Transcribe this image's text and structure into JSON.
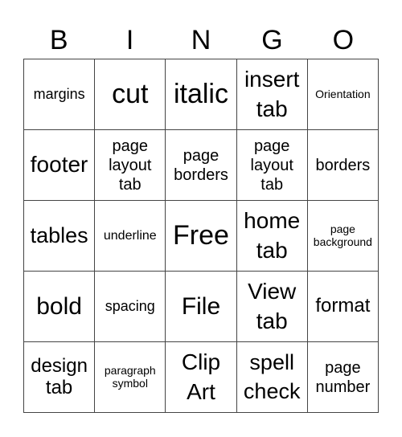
{
  "header": [
    "B",
    "I",
    "N",
    "G",
    "O"
  ],
  "cells": [
    [
      "margins",
      "cut",
      "italic",
      "insert tab",
      "Orientation"
    ],
    [
      "footer",
      "page layout tab",
      "page borders",
      "page layout tab",
      "borders"
    ],
    [
      "tables",
      "underline",
      "Free",
      "home tab",
      "page background"
    ],
    [
      "bold",
      "spacing",
      "File",
      "View tab",
      "format"
    ],
    [
      "design tab",
      "paragraph symbol",
      "Clip Art",
      "spell check",
      "page number"
    ]
  ]
}
